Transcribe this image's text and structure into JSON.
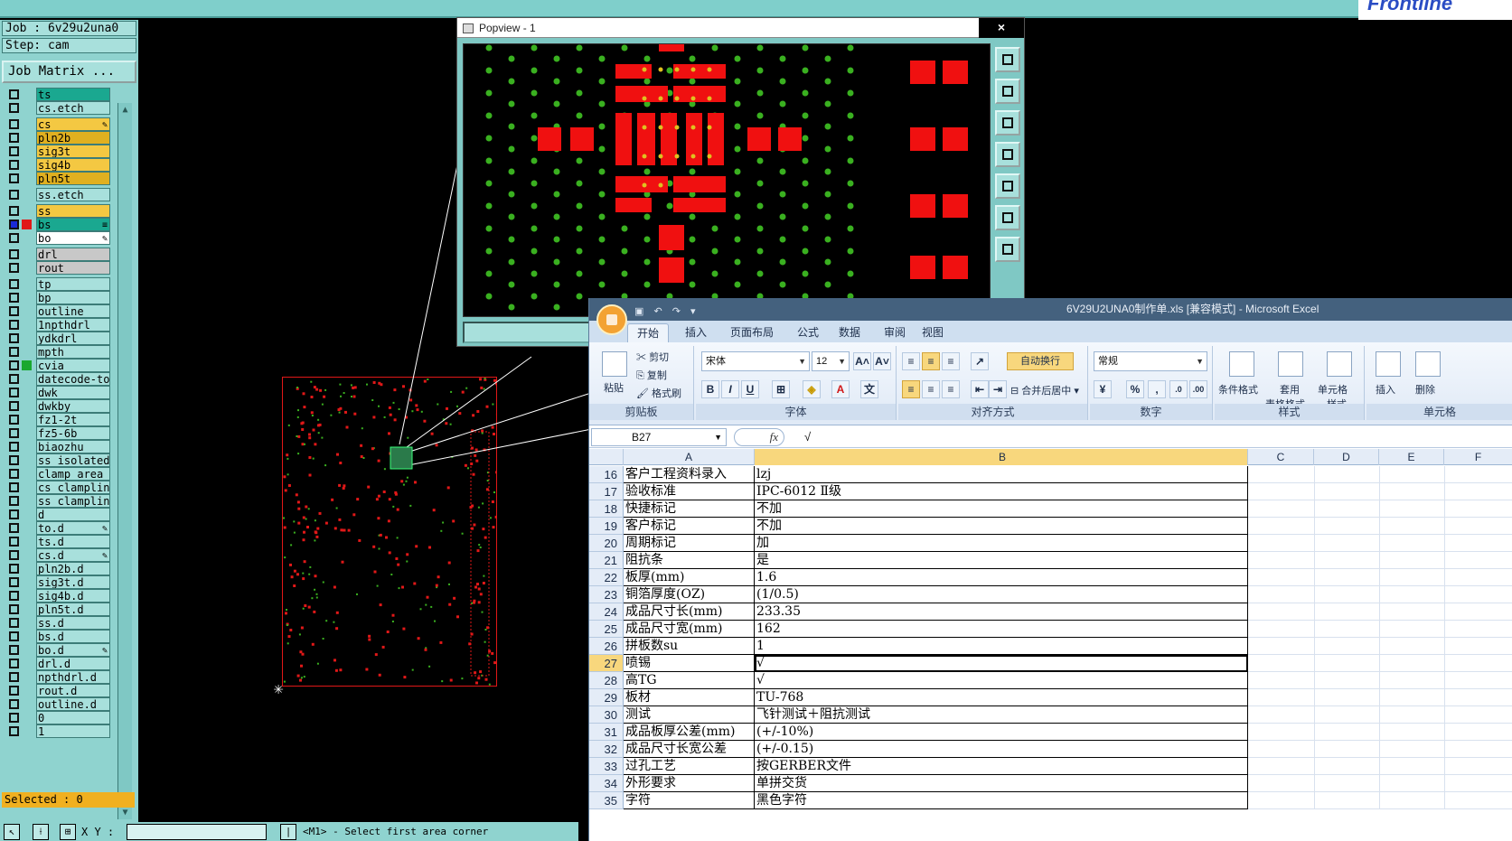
{
  "genesis": {
    "job_label": "Job : 6v29u2una0",
    "step_label": "Step: cam",
    "job_matrix_button": "Job Matrix ...",
    "selected_label": "Selected : 0",
    "xy_label": "X Y :",
    "status_message": "<M1> - Select first area corner",
    "brand_text": "Frontline",
    "layers": [
      {
        "name": "ts",
        "color": "#1aa890",
        "checked": false,
        "mark": "",
        "marker_color": ""
      },
      {
        "name": "cs.etch",
        "color": "#a8e0dc",
        "checked": false,
        "mark": "",
        "marker_color": ""
      },
      {
        "name": "cs",
        "color": "#f4c842",
        "checked": false,
        "mark": "✎",
        "marker_color": ""
      },
      {
        "name": "pln2b",
        "color": "#e0b020",
        "checked": false,
        "mark": "",
        "marker_color": ""
      },
      {
        "name": "sig3t",
        "color": "#f4c842",
        "checked": false,
        "mark": "",
        "marker_color": ""
      },
      {
        "name": "sig4b",
        "color": "#f4c842",
        "checked": false,
        "mark": "",
        "marker_color": ""
      },
      {
        "name": "pln5t",
        "color": "#e0b020",
        "checked": false,
        "mark": "",
        "marker_color": ""
      },
      {
        "name": "ss.etch",
        "color": "#a8e0dc",
        "checked": false,
        "mark": "",
        "marker_color": ""
      },
      {
        "name": "ss",
        "color": "#f4c842",
        "checked": false,
        "mark": "",
        "marker_color": ""
      },
      {
        "name": "bs",
        "color": "#1aa890",
        "checked": true,
        "mark": "≡",
        "marker_color": "#e01818"
      },
      {
        "name": "bo",
        "color": "#ffffff",
        "checked": false,
        "mark": "✎",
        "marker_color": ""
      },
      {
        "name": "drl",
        "color": "#c8c8c8",
        "checked": false,
        "mark": "",
        "marker_color": ""
      },
      {
        "name": "rout",
        "color": "#c8c8c8",
        "checked": false,
        "mark": "",
        "marker_color": ""
      },
      {
        "name": "tp",
        "color": "#a8e0dc",
        "checked": false,
        "mark": "",
        "marker_color": ""
      },
      {
        "name": "bp",
        "color": "#a8e0dc",
        "checked": false,
        "mark": "",
        "marker_color": ""
      },
      {
        "name": "outline",
        "color": "#a8e0dc",
        "checked": false,
        "mark": "",
        "marker_color": ""
      },
      {
        "name": "1npthdrl",
        "color": "#a8e0dc",
        "checked": false,
        "mark": "",
        "marker_color": ""
      },
      {
        "name": "ydkdrl",
        "color": "#a8e0dc",
        "checked": false,
        "mark": "",
        "marker_color": ""
      },
      {
        "name": "mpth",
        "color": "#a8e0dc",
        "checked": false,
        "mark": "",
        "marker_color": ""
      },
      {
        "name": "cvia",
        "color": "#a8e0dc",
        "checked": false,
        "mark": "",
        "marker_color": "#1aa830"
      },
      {
        "name": "datecode-to",
        "color": "#a8e0dc",
        "checked": false,
        "mark": "",
        "marker_color": ""
      },
      {
        "name": "dwk",
        "color": "#a8e0dc",
        "checked": false,
        "mark": "",
        "marker_color": ""
      },
      {
        "name": "dwkby",
        "color": "#a8e0dc",
        "checked": false,
        "mark": "",
        "marker_color": ""
      },
      {
        "name": "fz1-2t",
        "color": "#a8e0dc",
        "checked": false,
        "mark": "",
        "marker_color": ""
      },
      {
        "name": "fz5-6b",
        "color": "#a8e0dc",
        "checked": false,
        "mark": "",
        "marker_color": ""
      },
      {
        "name": "biaozhu",
        "color": "#a8e0dc",
        "checked": false,
        "mark": "",
        "marker_color": ""
      },
      {
        "name": "ss_isolated",
        "color": "#a8e0dc",
        "checked": false,
        "mark": "",
        "marker_color": ""
      },
      {
        "name": "clamp_area",
        "color": "#a8e0dc",
        "checked": false,
        "mark": "",
        "marker_color": ""
      },
      {
        "name": "cs_clampline",
        "color": "#a8e0dc",
        "checked": false,
        "mark": "",
        "marker_color": ""
      },
      {
        "name": "ss_clampline",
        "color": "#a8e0dc",
        "checked": false,
        "mark": "",
        "marker_color": ""
      },
      {
        "name": "d",
        "color": "#a8e0dc",
        "checked": false,
        "mark": "",
        "marker_color": ""
      },
      {
        "name": "to.d",
        "color": "#a8e0dc",
        "checked": false,
        "mark": "✎",
        "marker_color": ""
      },
      {
        "name": "ts.d",
        "color": "#a8e0dc",
        "checked": false,
        "mark": "",
        "marker_color": ""
      },
      {
        "name": "cs.d",
        "color": "#a8e0dc",
        "checked": false,
        "mark": "✎",
        "marker_color": ""
      },
      {
        "name": "pln2b.d",
        "color": "#a8e0dc",
        "checked": false,
        "mark": "",
        "marker_color": ""
      },
      {
        "name": "sig3t.d",
        "color": "#a8e0dc",
        "checked": false,
        "mark": "",
        "marker_color": ""
      },
      {
        "name": "sig4b.d",
        "color": "#a8e0dc",
        "checked": false,
        "mark": "",
        "marker_color": ""
      },
      {
        "name": "pln5t.d",
        "color": "#a8e0dc",
        "checked": false,
        "mark": "",
        "marker_color": ""
      },
      {
        "name": "ss.d",
        "color": "#a8e0dc",
        "checked": false,
        "mark": "",
        "marker_color": ""
      },
      {
        "name": "bs.d",
        "color": "#a8e0dc",
        "checked": false,
        "mark": "",
        "marker_color": ""
      },
      {
        "name": "bo.d",
        "color": "#a8e0dc",
        "checked": false,
        "mark": "✎",
        "marker_color": ""
      },
      {
        "name": "drl.d",
        "color": "#a8e0dc",
        "checked": false,
        "mark": "",
        "marker_color": ""
      },
      {
        "name": "npthdrl.d",
        "color": "#a8e0dc",
        "checked": false,
        "mark": "",
        "marker_color": ""
      },
      {
        "name": "rout.d",
        "color": "#a8e0dc",
        "checked": false,
        "mark": "",
        "marker_color": ""
      },
      {
        "name": "outline.d",
        "color": "#a8e0dc",
        "checked": false,
        "mark": "",
        "marker_color": ""
      },
      {
        "name": "0",
        "color": "#a8e0dc",
        "checked": false,
        "mark": "",
        "marker_color": ""
      },
      {
        "name": "1",
        "color": "#a8e0dc",
        "checked": false,
        "mark": "",
        "marker_color": ""
      }
    ]
  },
  "popview": {
    "title": "Popview - 1",
    "close_label": "×"
  },
  "excel": {
    "title": "6V29U2UNA0制作单.xls  [兼容模式] - Microsoft Excel",
    "tabs": [
      "开始",
      "插入",
      "页面布局",
      "公式",
      "数据",
      "审阅",
      "视图"
    ],
    "active_tab": 0,
    "ribbon": {
      "clipboard": {
        "label": "剪贴板",
        "paste": "粘贴",
        "cut": "剪切",
        "copy": "复制",
        "format_painter": "格式刷"
      },
      "font": {
        "label": "字体",
        "name": "宋体",
        "size": "12",
        "bold": "B",
        "italic": "I",
        "underline": "U",
        "grow": "A˄",
        "shrink": "A˅",
        "color_letter": "A"
      },
      "alignment": {
        "label": "对齐方式",
        "wrap": "自动换行",
        "merge": "合并后居中"
      },
      "number": {
        "label": "数字",
        "format": "常规",
        "percent": "%",
        "comma": ","
      },
      "styles": {
        "label": "样式",
        "conditional": "条件格式",
        "table_format_1": "套用",
        "table_format_2": "表格格式",
        "cell_style_1": "单元格",
        "cell_style_2": "样式"
      },
      "cells": {
        "label": "单元格",
        "insert": "插入",
        "delete": "删除"
      }
    },
    "name_box": "B27",
    "fx_label": "fx",
    "formula_value": "√",
    "columns": [
      {
        "label": "A",
        "selected": false
      },
      {
        "label": "B",
        "selected": true
      },
      {
        "label": "C",
        "selected": false
      },
      {
        "label": "D",
        "selected": false
      },
      {
        "label": "E",
        "selected": false
      },
      {
        "label": "F",
        "selected": false
      }
    ],
    "active_row": 27,
    "rows": [
      {
        "num": "16",
        "a": "客户工程资料录入",
        "b": "lzj"
      },
      {
        "num": "17",
        "a": "验收标准",
        "b": "IPC-6012 Ⅱ级"
      },
      {
        "num": "18",
        "a": "快捷标记",
        "b": "不加"
      },
      {
        "num": "19",
        "a": "客户标记",
        "b": "不加"
      },
      {
        "num": "20",
        "a": "周期标记",
        "b": "加"
      },
      {
        "num": "21",
        "a": "阻抗条",
        "b": "是"
      },
      {
        "num": "22",
        "a": "板厚(mm)",
        "b": "1.6"
      },
      {
        "num": "23",
        "a": "铜箔厚度(OZ)",
        "b": " (1/0.5)"
      },
      {
        "num": "24",
        "a": "成品尺寸长(mm)",
        "b": "233.35"
      },
      {
        "num": "25",
        "a": "成品尺寸宽(mm)",
        "b": "162"
      },
      {
        "num": "26",
        "a": "拼板数su",
        "b": "1"
      },
      {
        "num": "27",
        "a": "喷锡",
        "b": "√"
      },
      {
        "num": "28",
        "a": "高TG",
        "b": "√"
      },
      {
        "num": "29",
        "a": "板材",
        "b": "TU-768"
      },
      {
        "num": "30",
        "a": "测试",
        "b": "飞针测试＋阻抗测试"
      },
      {
        "num": "31",
        "a": "成品板厚公差(mm)",
        "b": "(+/-10%)"
      },
      {
        "num": "32",
        "a": "成品尺寸长宽公差",
        "b": "(+/-0.15)"
      },
      {
        "num": "33",
        "a": "过孔工艺",
        "b": "按GERBER文件"
      },
      {
        "num": "34",
        "a": "外形要求",
        "b": "单拼交货"
      },
      {
        "num": "35",
        "a": "字符",
        "b": "黑色字符"
      }
    ]
  }
}
